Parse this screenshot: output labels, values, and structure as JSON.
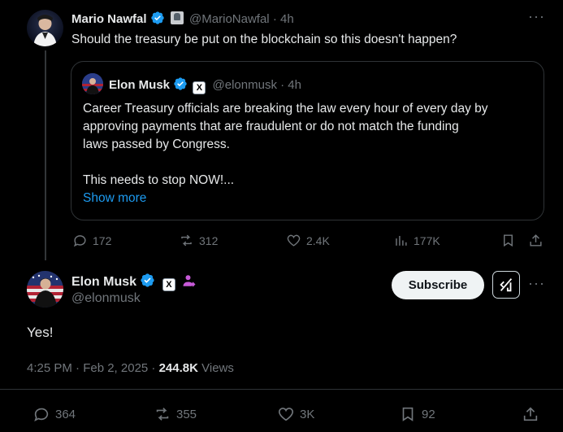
{
  "parent_tweet": {
    "author_name": "Mario Nawfal",
    "handle": "@MarioNawfal",
    "time": "· 4h",
    "text": "Should the treasury be put on the blockchain so this doesn't happen?",
    "quote": {
      "author_name": "Elon Musk",
      "handle": "@elonmusk",
      "time": "· 4h",
      "line1": "Career Treasury officials are breaking the law every hour of every day by",
      "line2": "approving payments that are fraudulent or do not match the funding",
      "line3": "laws passed by Congress.",
      "line4": "This needs to stop NOW!...",
      "show_more": "Show more",
      "affiliation_glyph": "X"
    },
    "stats": {
      "replies": "172",
      "reposts": "312",
      "likes": "2.4K",
      "views": "177K"
    }
  },
  "main_tweet": {
    "author_name": "Elon Musk",
    "handle": "@elonmusk",
    "affiliation_glyph": "X",
    "subscribe_label": "Subscribe",
    "text": "Yes!",
    "timestamp": "4:25 PM · Feb 2, 2025 ·",
    "views_count": "244.8K",
    "views_label": "Views",
    "stats": {
      "replies": "364",
      "reposts": "355",
      "likes": "3K",
      "bookmarks": "92"
    }
  },
  "colors": {
    "background": "#000000",
    "text": "#e7e9ea",
    "muted": "#71767b",
    "link": "#1d9bf0",
    "verified": "#1d9bf0",
    "border": "#2f3336"
  },
  "icons": [
    "verified-badge-icon",
    "x-affiliation-icon",
    "subscriber-person-icon",
    "reply-icon",
    "repost-icon",
    "like-icon",
    "views-icon",
    "bookmark-icon",
    "share-icon",
    "grok-icon",
    "more-icon"
  ]
}
